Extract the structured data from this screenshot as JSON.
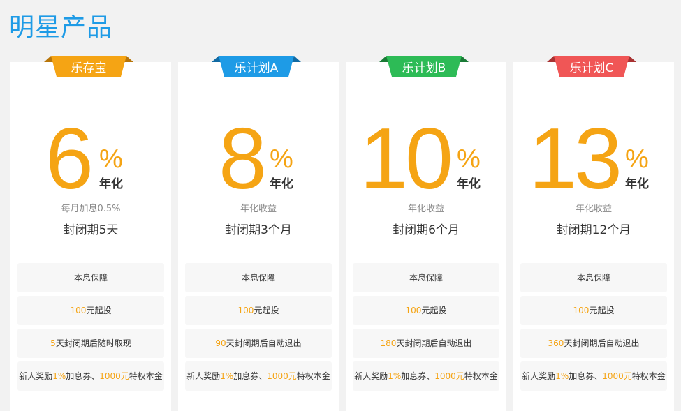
{
  "page_title": "明星产品",
  "colors": {
    "title": "#1e9be6",
    "accent": "#f5a414",
    "ribbon_orange": "#f5a414",
    "ribbon_blue": "#1e9be6",
    "ribbon_green": "#2dbb56",
    "ribbon_red": "#f05656"
  },
  "products": [
    {
      "name": "乐存宝",
      "ribbon_color": "#f5a414",
      "rate": "6",
      "percent": "%",
      "unit": "年化",
      "rate_desc": "每月加息0.5%",
      "period": "封闭期5天",
      "features": {
        "guarantee": "本息保障",
        "min_amount": "100",
        "min_suffix": "元起投",
        "term_days": "5",
        "term_suffix": "天封闭期后随时取现",
        "bonus_prefix": "新人奖励",
        "bonus_rate": "1%",
        "bonus_middle": "加息券、",
        "bonus_amount": "1000元",
        "bonus_suffix": "特权本金"
      }
    },
    {
      "name": "乐计划A",
      "ribbon_color": "#1e9be6",
      "rate": "8",
      "percent": "%",
      "unit": "年化",
      "rate_desc": "年化收益",
      "period": "封闭期3个月",
      "features": {
        "guarantee": "本息保障",
        "min_amount": "100",
        "min_suffix": "元起投",
        "term_days": "90",
        "term_suffix": "天封闭期后自动退出",
        "bonus_prefix": "新人奖励",
        "bonus_rate": "1%",
        "bonus_middle": "加息券、",
        "bonus_amount": "1000元",
        "bonus_suffix": "特权本金"
      }
    },
    {
      "name": "乐计划B",
      "ribbon_color": "#2dbb56",
      "rate": "10",
      "percent": "%",
      "unit": "年化",
      "rate_desc": "年化收益",
      "period": "封闭期6个月",
      "features": {
        "guarantee": "本息保障",
        "min_amount": "100",
        "min_suffix": "元起投",
        "term_days": "180",
        "term_suffix": "天封闭期后自动退出",
        "bonus_prefix": "新人奖励",
        "bonus_rate": "1%",
        "bonus_middle": "加息券、",
        "bonus_amount": "1000元",
        "bonus_suffix": "特权本金"
      }
    },
    {
      "name": "乐计划C",
      "ribbon_color": "#f05656",
      "rate": "13",
      "percent": "%",
      "unit": "年化",
      "rate_desc": "年化收益",
      "period": "封闭期12个月",
      "features": {
        "guarantee": "本息保障",
        "min_amount": "100",
        "min_suffix": "元起投",
        "term_days": "360",
        "term_suffix": "天封闭期后自动退出",
        "bonus_prefix": "新人奖励",
        "bonus_rate": "1%",
        "bonus_middle": "加息券、",
        "bonus_amount": "1000元",
        "bonus_suffix": "特权本金"
      }
    }
  ]
}
